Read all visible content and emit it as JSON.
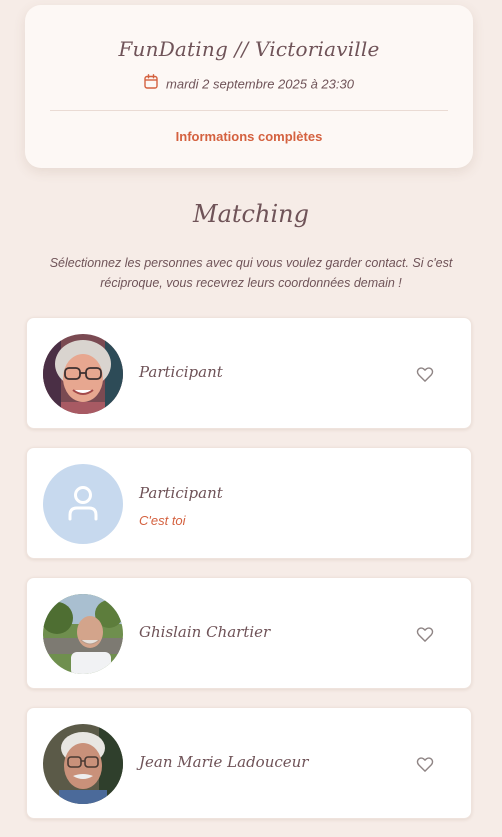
{
  "event": {
    "title": "FunDating // Victoriaville",
    "date": "mardi 2 septembre 2025 à 23:30",
    "info_link": "Informations complètes"
  },
  "matching": {
    "title": "Matching",
    "instructions": "Sélectionnez les personnes avec qui vous voulez garder contact. Si c'est réciproque, vous recevrez leurs coordonnées demain !",
    "people": [
      {
        "name": "Participant",
        "photo": "photo-woman-glasses",
        "liked": false
      },
      {
        "name": "Participant",
        "you_label": "C'est toi",
        "photo": "user-placeholder-icon"
      },
      {
        "name": "Ghislain Chartier",
        "photo": "photo-man-outdoors",
        "liked": false
      },
      {
        "name": "Jean Marie Ladouceur",
        "photo": "photo-man-glasses",
        "liked": false
      }
    ]
  },
  "colors": {
    "background": "#f6ece7",
    "card": "#ffffff",
    "accent": "#d4613f",
    "text": "#6f5358",
    "placeholder_avatar": "#c7d9ee"
  }
}
